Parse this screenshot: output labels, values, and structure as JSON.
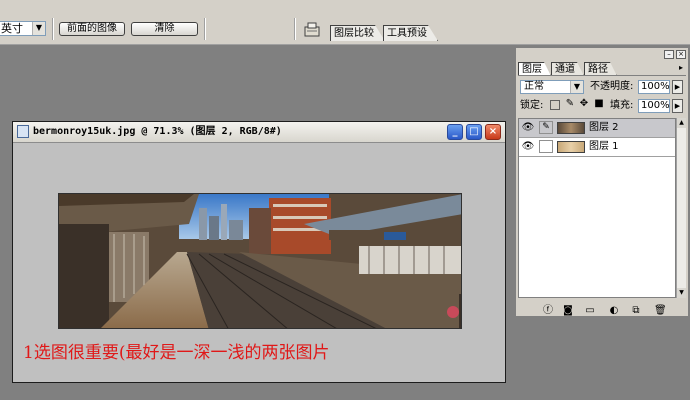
{
  "options_bar": {
    "unit_value": "英寸",
    "front_image_button": "前面的图像",
    "clear_button": "清除",
    "tabs": [
      "图层比较",
      "工具预设"
    ]
  },
  "document": {
    "title": "bermonroy15uk.jpg @ 71.3% (图层 2, RGB/8#)",
    "caption": "1选图很重要(最好是一深一浅的两张图片"
  },
  "layers_panel": {
    "tabs": [
      "图层",
      "通道",
      "路径"
    ],
    "blend_mode": "正常",
    "opacity_label": "不透明度:",
    "opacity_value": "100%",
    "lock_label": "锁定:",
    "fill_label": "填充:",
    "fill_value": "100%",
    "layers": [
      {
        "name": "图层 2",
        "selected": true
      },
      {
        "name": "图层 1",
        "selected": false
      }
    ]
  },
  "colors": {
    "workspace": "#808080",
    "chrome": "#d4d0c8",
    "caption": "#e01818"
  }
}
